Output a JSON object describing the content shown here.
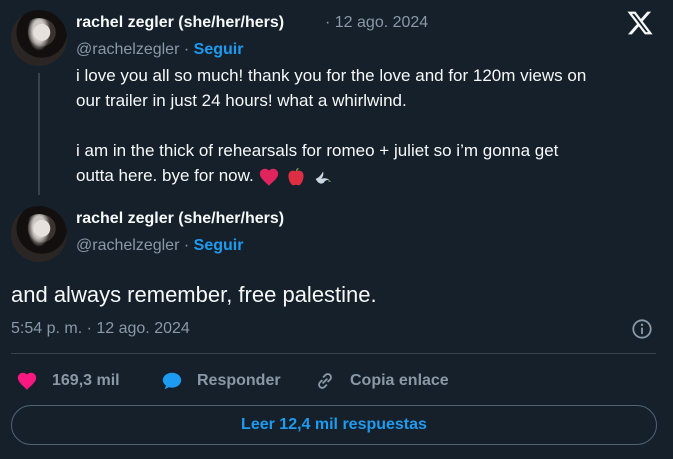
{
  "tweet1": {
    "author_name": "rachel zegler (she/her/hers)",
    "separator": "·",
    "date": "12 ago. 2024",
    "handle": "@rachelzegler",
    "follow_label": "Seguir",
    "text_line1": "i love you all so much! thank you for the love and for 120m views on",
    "text_line2": "our trailer in just 24 hours! what a whirlwind.",
    "text_line3": "i am in the thick of rehearsals for romeo + juliet so i’m gonna get",
    "text_line4": "outta here. bye for now.",
    "emojis": [
      "heart-emoji",
      "apple-emoji",
      "dove-emoji"
    ]
  },
  "tweet2": {
    "author_name": "rachel zegler (she/her/hers)",
    "handle": "@rachelzegler",
    "separator": "·",
    "follow_label": "Seguir",
    "text": "and always remember, free palestine.",
    "timestamp": "5:54 p. m. · 12 ago. 2024"
  },
  "actions": {
    "like_count": "169,3 mil",
    "reply_label": "Responder",
    "copy_link_label": "Copia enlace"
  },
  "read_replies_label": "Leer 12,4 mil respuestas",
  "colors": {
    "background": "#15202b",
    "accent": "#1d9bf0",
    "like": "#f91880",
    "secondary_text": "#8b98a5"
  }
}
